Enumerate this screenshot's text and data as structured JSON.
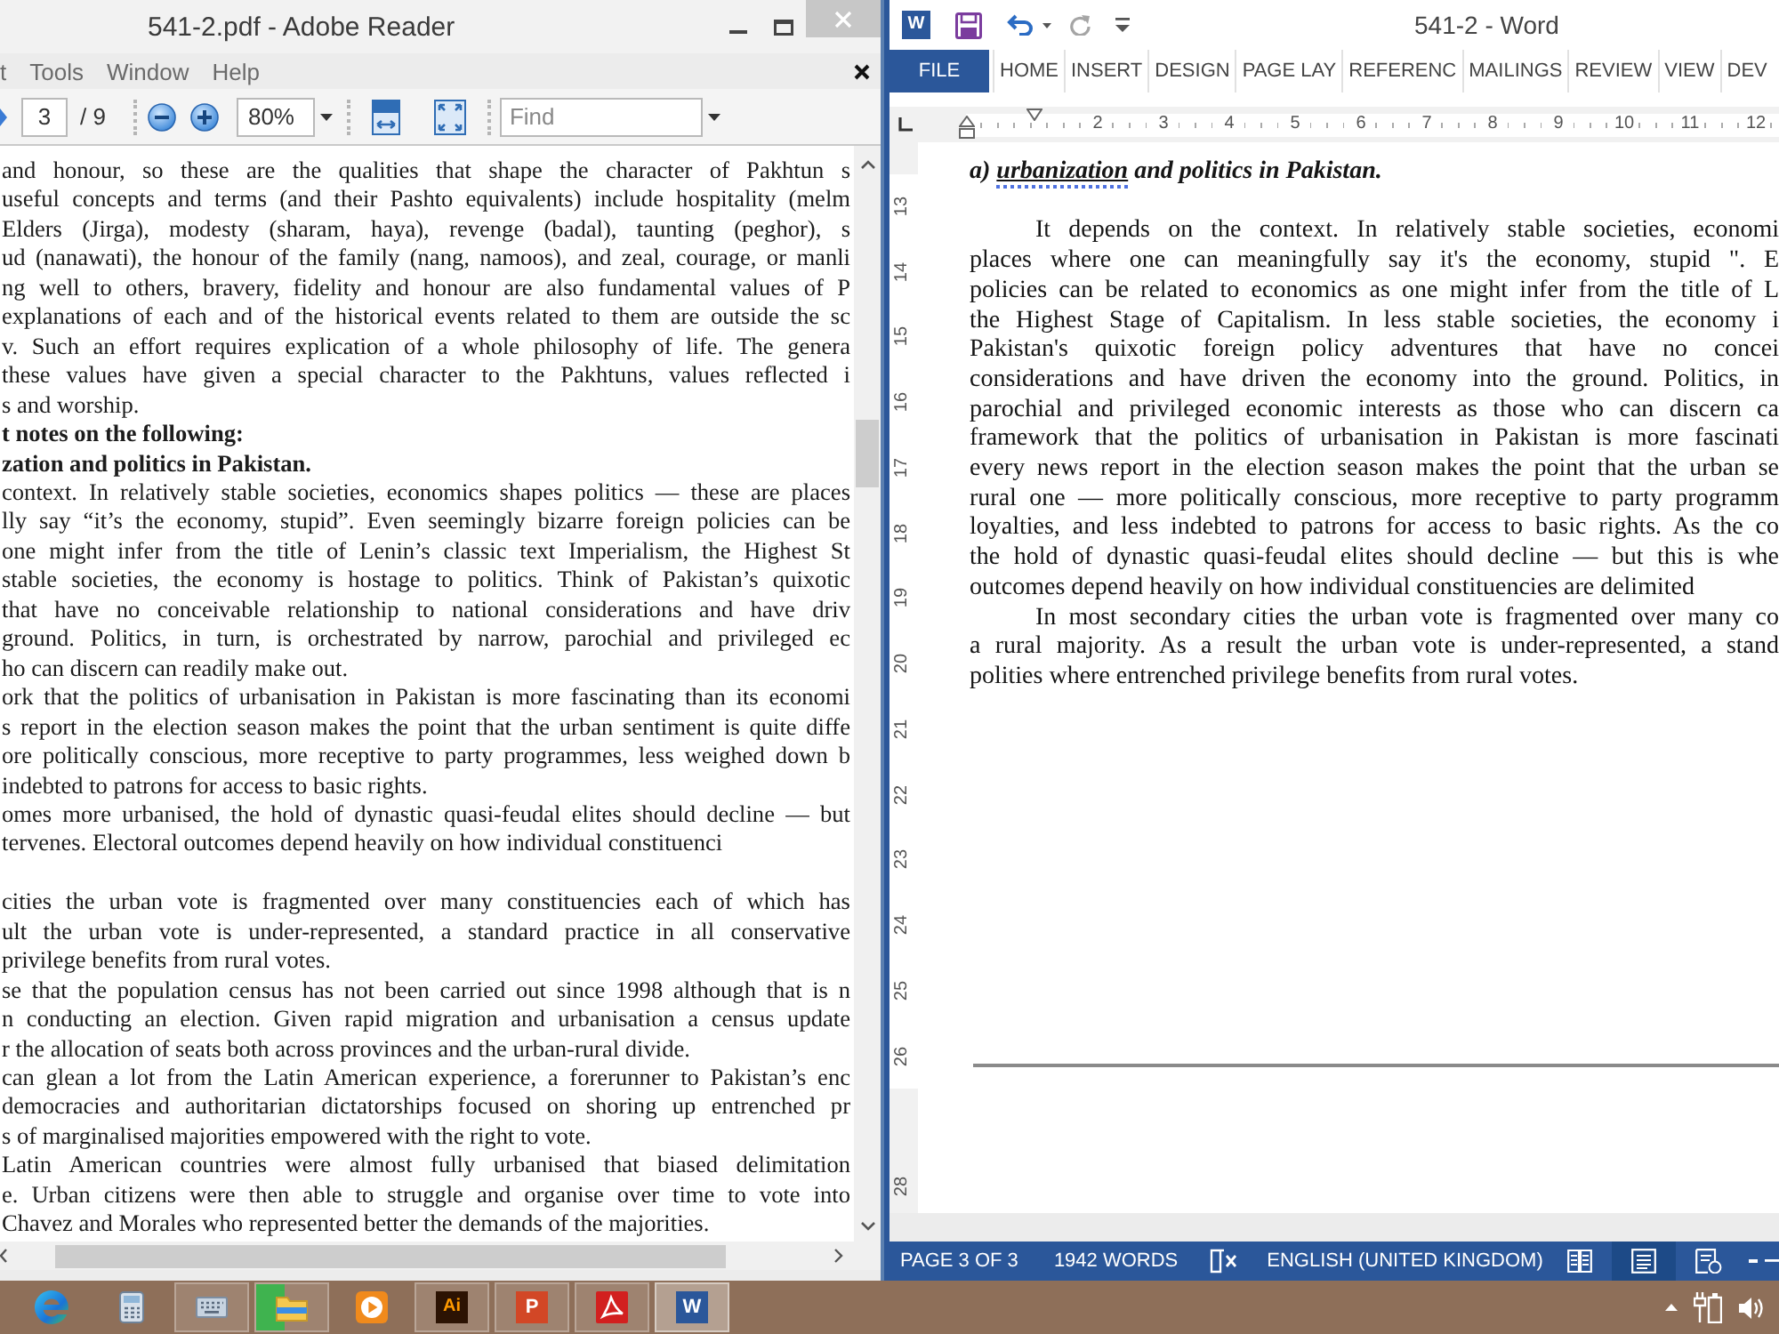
{
  "reader": {
    "title": "541-2.pdf - Adobe Reader",
    "menu": [
      "t",
      "Tools",
      "Window",
      "Help"
    ],
    "toolbar": {
      "page": "3",
      "page_count": "/ 9",
      "zoom": "80%",
      "find": {
        "placeholder": "Find"
      }
    },
    "document": {
      "sections": [
        [
          {
            "kind": "body",
            "lines": [
              "and honour, so these are the qualities that shape the character of Pakhtun s",
              "useful concepts and terms (and their Pashto equivalents) include hospitality (melm",
              "Elders (Jirga), modesty (sharam, haya), revenge (badal), taunting (peghor), s",
              "ud (nanawati), the honour of the family (nang, namoos), and zeal, courage, or manli",
              "ng well to others, bravery, fidelity and honour are also fundamental values of P",
              "explanations of each and of the historical events related to them are outside the sc",
              "v. Such an effort requires explication of a whole philosophy of life. The genera",
              "these values have given a special character to the Pakhtuns, values reflected i",
              "s and worship."
            ]
          },
          {
            "kind": "heading",
            "lines": [
              "t notes on the following:"
            ]
          },
          {
            "kind": "heading",
            "lines": [
              "zation and politics in Pakistan."
            ]
          },
          {
            "kind": "body",
            "lines": [
              "context. In relatively stable societies, economics shapes politics — these are places",
              "lly say “it’s the economy, stupid”. Even seemingly bizarre foreign policies can be",
              "one might infer from the title of Lenin’s classic text Imperialism, the Highest St",
              "stable societies, the economy is hostage to politics. Think of Pakistan’s quixotic",
              "that have no conceivable relationship to national considerations and have driv",
              "ground. Politics, in turn, is orchestrated by narrow, parochial and privileged ec",
              "ho can discern can readily make out."
            ]
          },
          {
            "kind": "body",
            "lines": [
              "ork that the politics of urbanisation in Pakistan is more fascinating than its economi",
              "s report in the election season makes the point that the urban sentiment is quite diffe",
              "ore politically conscious, more receptive to party programmes, less weighed down b",
              "indebted to patrons for access to basic rights."
            ]
          },
          {
            "kind": "body",
            "lines": [
              "omes more urbanised, the hold of dynastic quasi-feudal elites should decline — but",
              "tervenes. Electoral outcomes depend heavily on how individual constituenci"
            ]
          }
        ],
        [
          {
            "kind": "body",
            "lines": [
              "cities the urban vote is fragmented over many constituencies each of which has",
              "ult the urban vote is under-represented, a standard practice in all conservative",
              "privilege benefits from rural votes."
            ]
          },
          {
            "kind": "body",
            "lines": [
              "se that the population census has not been carried out since 1998 although that is n",
              "n conducting an election. Given rapid migration and urbanisation a census update",
              "r the allocation of seats both across provinces and the urban-rural divide."
            ]
          },
          {
            "kind": "body",
            "lines": [
              "can glean a lot from the Latin American experience, a forerunner to Pakistan’s enc",
              "democracies and authoritarian dictatorships focused on shoring up entrenched pr",
              "s of marginalised majorities empowered with the right to vote."
            ]
          },
          {
            "kind": "body",
            "lines": [
              "Latin American countries were almost fully urbanised that biased delimitation",
              "e. Urban citizens were then able to struggle and organise over time to vote into",
              "Chavez and Morales who represented better the demands of the majorities."
            ]
          }
        ]
      ]
    }
  },
  "word": {
    "logo": "W",
    "title": "541-2 - Word",
    "tabs": [
      {
        "label": "FILE",
        "kind": "file"
      },
      {
        "label": "HOME",
        "kind": "tab"
      },
      {
        "label": "INSERT",
        "kind": "tab"
      },
      {
        "label": "DESIGN",
        "kind": "tab"
      },
      {
        "label": "PAGE LAY",
        "kind": "tab"
      },
      {
        "label": "REFERENC",
        "kind": "tab"
      },
      {
        "label": "MAILINGS",
        "kind": "tab"
      },
      {
        "label": "REVIEW",
        "kind": "tab"
      },
      {
        "label": "VIEW",
        "kind": "tab"
      },
      {
        "label": "DEV",
        "kind": "tab"
      }
    ],
    "ruler": [
      "2",
      "3",
      "4",
      "5",
      "6",
      "7",
      "8",
      "9",
      "10",
      "11",
      "12"
    ],
    "vertical_ruler": [
      [
        "13",
        "14",
        "15",
        "16",
        "17",
        "18",
        "19",
        "20",
        "21",
        "22",
        "23",
        "24",
        "25",
        "26"
      ],
      [
        "28"
      ]
    ],
    "heading": [
      {
        "text": "a)",
        "underlined": false,
        "misspelled": false
      },
      {
        "text": "urbanization",
        "underlined": true,
        "misspelled": true
      },
      {
        "text": "and politics in Pakistan.",
        "underlined": false,
        "misspelled": false
      }
    ],
    "paragraphs": [
      {
        "lines": [
          "It depends on the context. In relatively stable societies, economi",
          "places where one can meaningfully say it's the economy, stupid \". E",
          "policies can be related to economics as one might infer from the title of L",
          "the Highest Stage of Capitalism. In less stable societies, the economy i",
          "Pakistan's quixotic foreign policy adventures that have no concei",
          "considerations and have driven the economy into the ground. Politics, in",
          "parochial and privileged economic interests as those who can discern ca",
          "framework that the politics of urbanisation in Pakistan is more fascinati",
          "every news report in the election season makes the point that the urban se",
          "rural one — more politically conscious, more receptive to party programm",
          "loyalties, and less indebted to patrons for access to basic rights. As the co",
          "the hold of dynastic quasi-feudal elites should decline — but this is whe",
          "outcomes depend heavily on how individual constituencies are delimited"
        ]
      },
      {
        "lines": [
          "In most secondary cities the urban vote is fragmented over many co",
          "a rural majority. As a result the urban vote is under-represented, a stand",
          "polities where entrenched privilege benefits from rural votes."
        ]
      }
    ],
    "status_bar": {
      "page": "PAGE 3 OF 3",
      "words": "1942 WORDS",
      "language": "ENGLISH (UNITED KINGDOM)",
      "views": [
        {
          "kind": "read",
          "selected": false
        },
        {
          "kind": "print",
          "selected": true
        },
        {
          "kind": "web",
          "selected": false
        }
      ]
    }
  },
  "taskbar": {
    "items": [
      {
        "kind": "browser",
        "running": false,
        "selected": false
      },
      {
        "kind": "calculator",
        "running": false,
        "selected": false
      },
      {
        "kind": "keyboard",
        "running": true,
        "selected": false
      },
      {
        "kind": "folder",
        "running": true,
        "selected": false,
        "level": 0.4
      },
      {
        "kind": "media",
        "running": false,
        "selected": false
      },
      {
        "kind": "illustrator",
        "label": "Ai",
        "running": true,
        "selected": false
      },
      {
        "kind": "powerpoint",
        "label": "P",
        "running": true,
        "selected": false
      },
      {
        "kind": "acrobat",
        "running": true,
        "selected": false
      },
      {
        "kind": "word",
        "label": "W",
        "running": true,
        "selected": true
      }
    ]
  }
}
